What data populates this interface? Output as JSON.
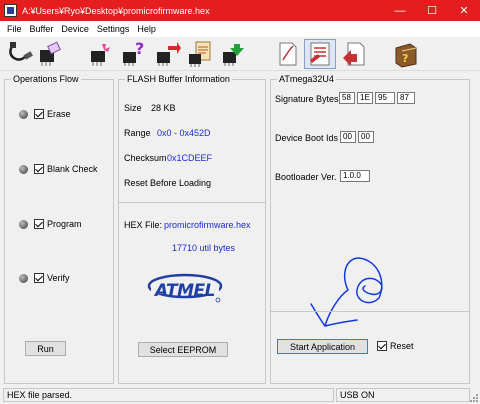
{
  "window": {
    "title": "A:¥Users¥Ryo¥Desktop¥promicrofirmware.hex",
    "minimize": "—",
    "maximize": "☐",
    "close": "✕"
  },
  "menu": [
    "File",
    "Buffer",
    "Device",
    "Settings",
    "Help"
  ],
  "toolbar": {
    "icons": [
      "usb-cable-icon",
      "chip-erase-icon",
      "chip-blank-check-icon",
      "chip-read-icon",
      "chip-program-icon",
      "chip-verify-icon",
      "document-edit-icon",
      "settings-document-icon",
      "document-run-icon",
      "help-book-icon"
    ]
  },
  "operations": {
    "title": "Operations Flow",
    "items": [
      "Erase",
      "Blank Check",
      "Program",
      "Verify"
    ],
    "run_label": "Run"
  },
  "flash": {
    "title": "FLASH Buffer Information",
    "size_label": "Size",
    "size_value": "28 KB",
    "range_label": "Range",
    "range_value": "0x0 - 0x452D",
    "checksum_label": "Checksum",
    "checksum_value": "0x1CDEEF",
    "reset_label": "Reset Before Loading",
    "hex_label": "HEX File:",
    "hex_value": "promicrofirmware.hex",
    "bytes_info": "17710 util bytes",
    "logo_text": "ATMEL",
    "eeprom_label": "Select EEPROM"
  },
  "device": {
    "title": "ATmega32U4",
    "sig_label": "Signature Bytes",
    "sig_values": [
      "58",
      "1E",
      "95",
      "87"
    ],
    "boot_label": "Device Boot Ids",
    "boot_values": [
      "00",
      "00"
    ],
    "bootloader_label": "Bootloader Ver.",
    "bootloader_value": "1.0.0",
    "start_label": "Start Application",
    "reset_label": "Reset"
  },
  "status": {
    "message": "HEX file parsed.",
    "usb": "USB ON"
  },
  "colors": {
    "titlebar": "#e41e1e",
    "accent_blue": "#1a2ad6",
    "atmel_blue": "#1f3fa6",
    "scribble": "#1438e0"
  }
}
